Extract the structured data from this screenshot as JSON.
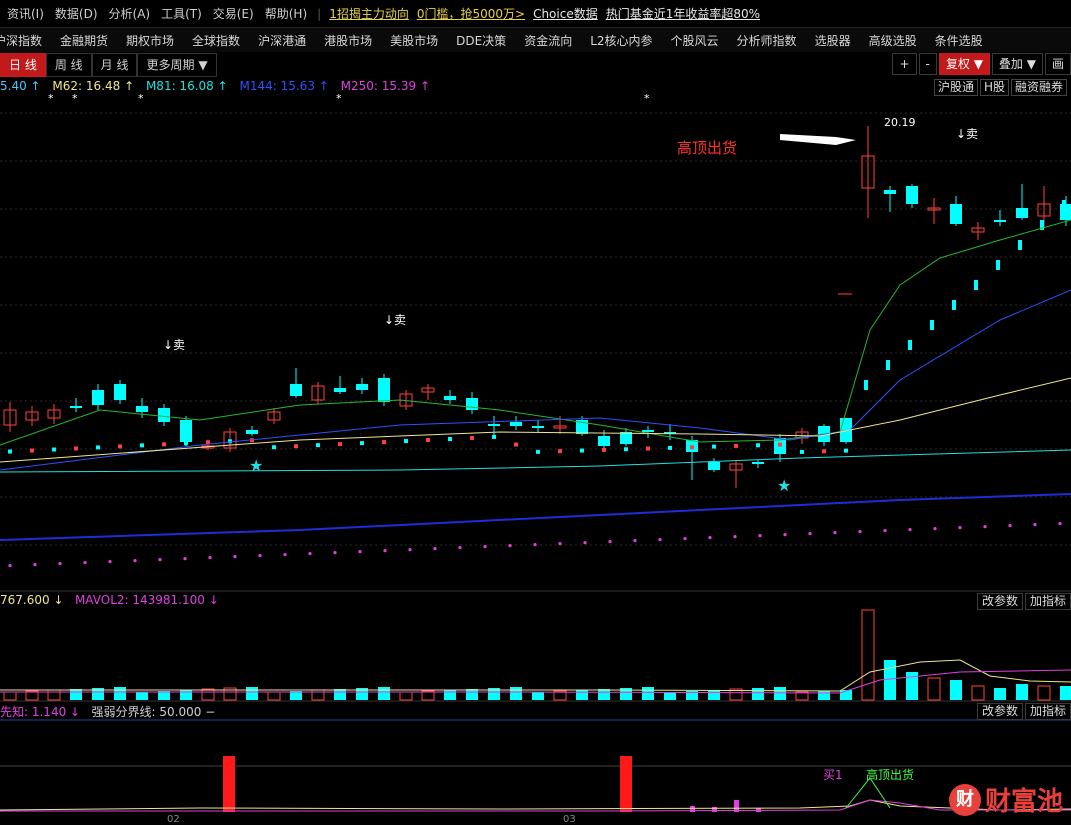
{
  "menu": [
    "资讯(I)",
    "数据(D)",
    "分析(A)",
    "工具(T)",
    "交易(E)",
    "帮助(H)"
  ],
  "ads": [
    "1招揭主力动向",
    "0门槛，抢5000万>",
    "Choice数据",
    "热门基金近1年收益率超80%"
  ],
  "nav": [
    "沪深指数",
    "金融期货",
    "期权市场",
    "全球指数",
    "沪深港通",
    "港股市场",
    "美股市场",
    "DDE决策",
    "资金流向",
    "L2核心内参",
    "个股风云",
    "分析师指数",
    "选股器",
    "高级选股",
    "条件选股"
  ],
  "periods": [
    "日 线",
    "周 线",
    "月 线",
    "更多周期"
  ],
  "right_buttons": [
    "+",
    "-",
    "复权",
    "叠加",
    "画"
  ],
  "ma_legend": [
    {
      "text": "5.40 ↑",
      "color": "#4ec3ff"
    },
    {
      "text": "M62: 16.48 ↑",
      "color": "#f0e68c"
    },
    {
      "text": "M81: 16.08 ↑",
      "color": "#20e0e0"
    },
    {
      "text": "M144: 15.63 ↑",
      "color": "#3050ff"
    },
    {
      "text": "M250: 15.39 ↑",
      "color": "#e040e0"
    }
  ],
  "tags": [
    "沪股通",
    "H股",
    "融资融券"
  ],
  "annotations": {
    "high_price": "20.19",
    "high_label": "高顶出货",
    "sell": "↓卖",
    "buy": "买1"
  },
  "vol_legend": [
    {
      "text": "767.600 ↓",
      "color": "#f0e68c"
    },
    {
      "text": "MAVOL2: 143981.100 ↓",
      "color": "#e040e0"
    }
  ],
  "ind_legend": [
    {
      "text": "先知: 1.140 ↓",
      "color": "#e040e0"
    },
    {
      "text": "强弱分界线: 50.000 −",
      "color": "#d0d0d0"
    }
  ],
  "panel_buttons": [
    "改参数",
    "加指标"
  ],
  "date_ticks": [
    "02",
    "03"
  ],
  "logo": {
    "mark": "财",
    "text": "财富池"
  },
  "colors": {
    "up": "#ff4040",
    "down": "#00ffff",
    "active": "#c21a1a"
  }
}
